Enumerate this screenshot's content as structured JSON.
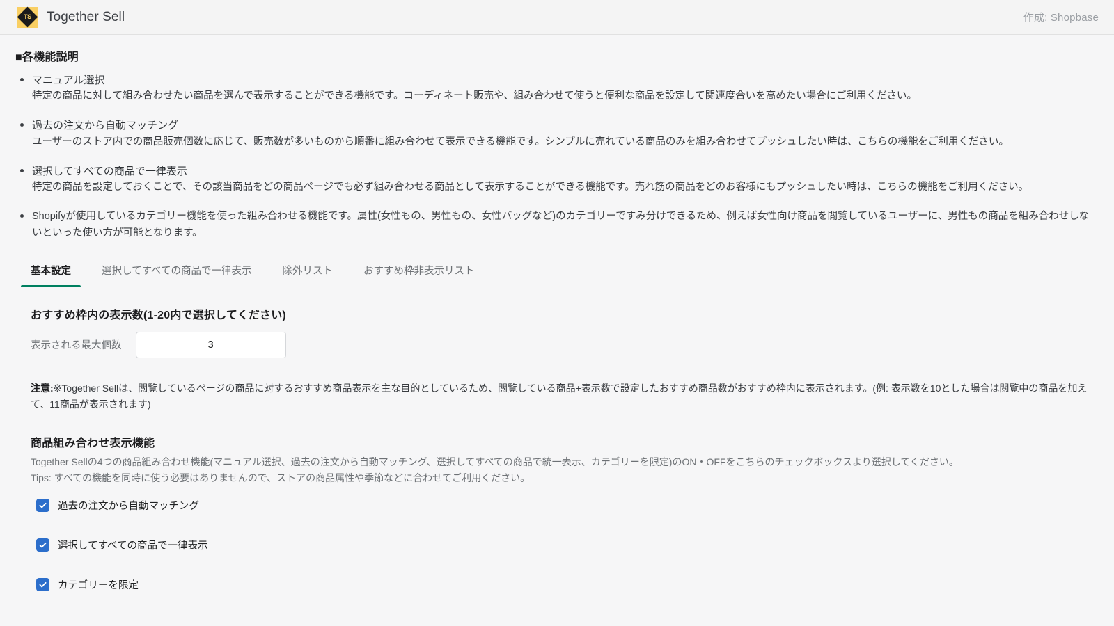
{
  "topbar": {
    "app_name": "Together Sell",
    "logo_text": "TS",
    "logo_bg": "#f9cf63",
    "credit": "作成: Shopbase"
  },
  "features_section": {
    "heading": "■各機能説明",
    "items": [
      {
        "title": "マニュアル選択",
        "desc": "特定の商品に対して組み合わせたい商品を選んで表示することができる機能です。コーディネート販売や、組み合わせて使うと便利な商品を設定して関連度合いを高めたい場合にご利用ください。"
      },
      {
        "title": "過去の注文から自動マッチング",
        "desc": "ユーザーのストア内での商品販売個数に応じて、販売数が多いものから順番に組み合わせて表示できる機能です。シンプルに売れている商品のみを組み合わせてプッシュしたい時は、こちらの機能をご利用ください。"
      },
      {
        "title": "選択してすべての商品で一律表示",
        "desc": "特定の商品を設定しておくことで、その該当商品をどの商品ページでも必ず組み合わせる商品として表示することができる機能です。売れ筋の商品をどのお客様にもプッシュしたい時は、こちらの機能をご利用ください。"
      },
      {
        "title": "",
        "desc": "Shopifyが使用しているカテゴリー機能を使った組み合わせる機能です。属性(女性もの、男性もの、女性バッグなど)のカテゴリーですみ分けできるため、例えば女性向け商品を閲覧しているユーザーに、男性もの商品を組み合わせしないといった使い方が可能となります。"
      }
    ]
  },
  "tabs": {
    "active_index": 0,
    "accent_color": "#008060",
    "items": [
      {
        "label": "基本設定"
      },
      {
        "label": "選択してすべての商品で一律表示"
      },
      {
        "label": "除外リスト"
      },
      {
        "label": "おすすめ枠非表示リスト"
      }
    ]
  },
  "display_count": {
    "title": "おすすめ枠内の表示数(1-20内で選択してください)",
    "label": "表示される最大個数",
    "value": "3",
    "placeholder": ""
  },
  "notice": {
    "prefix": "注意:",
    "text": "※Together Sellは、閲覧しているページの商品に対するおすすめ商品表示を主な目的としているため、閲覧している商品+表示数で設定したおすすめ商品数がおすすめ枠内に表示されます。(例: 表示数を10とした場合は閲覧中の商品を加えて、11商品が表示されます)"
  },
  "combination": {
    "title": "商品組み合わせ表示機能",
    "desc": "Together Sellの4つの商品組み合わせ機能(マニュアル選択、過去の注文から自動マッチング、選択してすべての商品で統一表示、カテゴリーを限定)のON・OFFをこちらのチェックボックスより選択してください。",
    "tips": "Tips: すべての機能を同時に使う必要はありませんので、ストアの商品属性や季節などに合わせてご利用ください。",
    "checkbox_color": "#2c6ecb",
    "checkboxes": [
      {
        "label": "過去の注文から自動マッチング",
        "checked": true
      },
      {
        "label": "選択してすべての商品で一律表示",
        "checked": true
      },
      {
        "label": "カテゴリーを限定",
        "checked": true
      }
    ]
  }
}
